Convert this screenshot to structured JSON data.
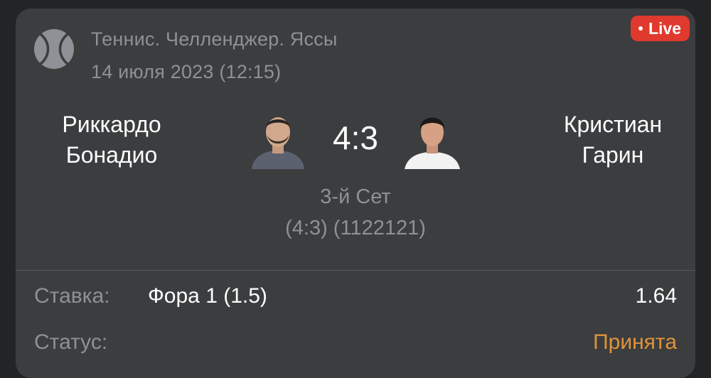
{
  "header": {
    "tournament": "Теннис. Челленджер. Яссы",
    "datetime": "14 июля 2023 (12:15)",
    "live_label": "Live",
    "sport_icon": "tennis-ball-icon"
  },
  "match": {
    "player1": {
      "first_name": "Риккардо",
      "last_name": "Бонадио"
    },
    "player2": {
      "first_name": "Кристиан",
      "last_name": "Гарин"
    },
    "score": "4:3",
    "set_label": "3-й Сет",
    "set_detail": "(4:3) (1122121)"
  },
  "bet": {
    "stake_label": "Ставка:",
    "stake_value": "Фора 1 (1.5)",
    "odds": "1.64",
    "status_label": "Статус:",
    "status_value": "Принята"
  },
  "colors": {
    "background": "#222425",
    "card": "#3b3d3f",
    "muted_text": "#8e9195",
    "live_badge": "#e0392e",
    "status_accepted": "#e0933a"
  }
}
